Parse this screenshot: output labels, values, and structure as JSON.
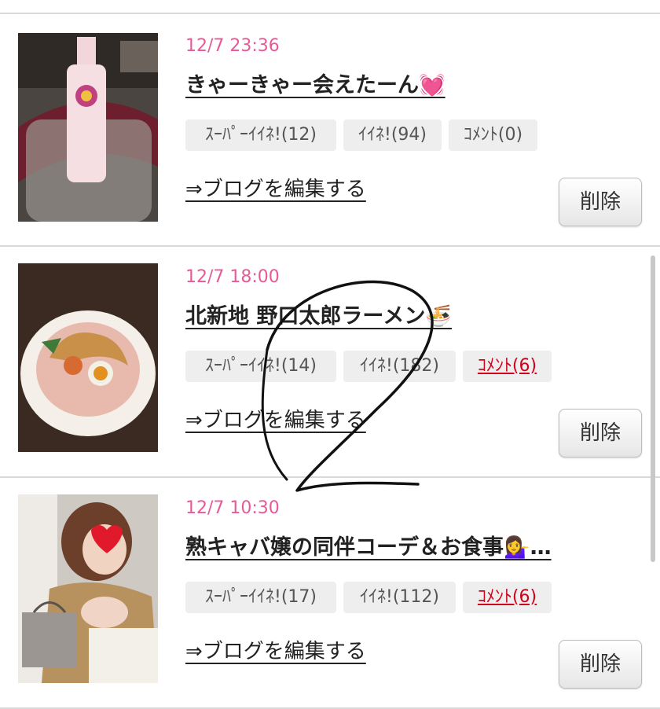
{
  "posts": [
    {
      "date": "12/7 23:36",
      "title": "きゃーきゃー会えたーん💓",
      "super_like": "ｽｰﾊﾟｰｲｲﾈ!(12)",
      "like": "ｲｲﾈ!(94)",
      "comment": "ｺﾒﾝﾄ(0)",
      "edit": "⇒ブログを編集する",
      "delete": "削除",
      "image_icon": "champagne-photo"
    },
    {
      "date": "12/7 18:00",
      "title": "北新地 野口太郎ラーメン🍜",
      "super_like": "ｽｰﾊﾟｰｲｲﾈ!(14)",
      "like": "ｲｲﾈ!(182)",
      "comment": "ｺﾒﾝﾄ(6)",
      "edit": "⇒ブログを編集する",
      "delete": "削除",
      "image_icon": "ramen-photo"
    },
    {
      "date": "12/7 10:30",
      "title": "熟キャバ嬢の同伴コーデ＆お食事💁‍♀️…",
      "super_like": "ｽｰﾊﾟｰｲｲﾈ!(17)",
      "like": "ｲｲﾈ!(112)",
      "comment": "ｺﾒﾝﾄ(6)",
      "edit": "⇒ブログを編集する",
      "delete": "削除",
      "image_icon": "outfit-photo"
    }
  ],
  "colors": {
    "date": "#e75a98",
    "comment_active": "#d0021b",
    "badge_bg": "#eeeeee"
  }
}
